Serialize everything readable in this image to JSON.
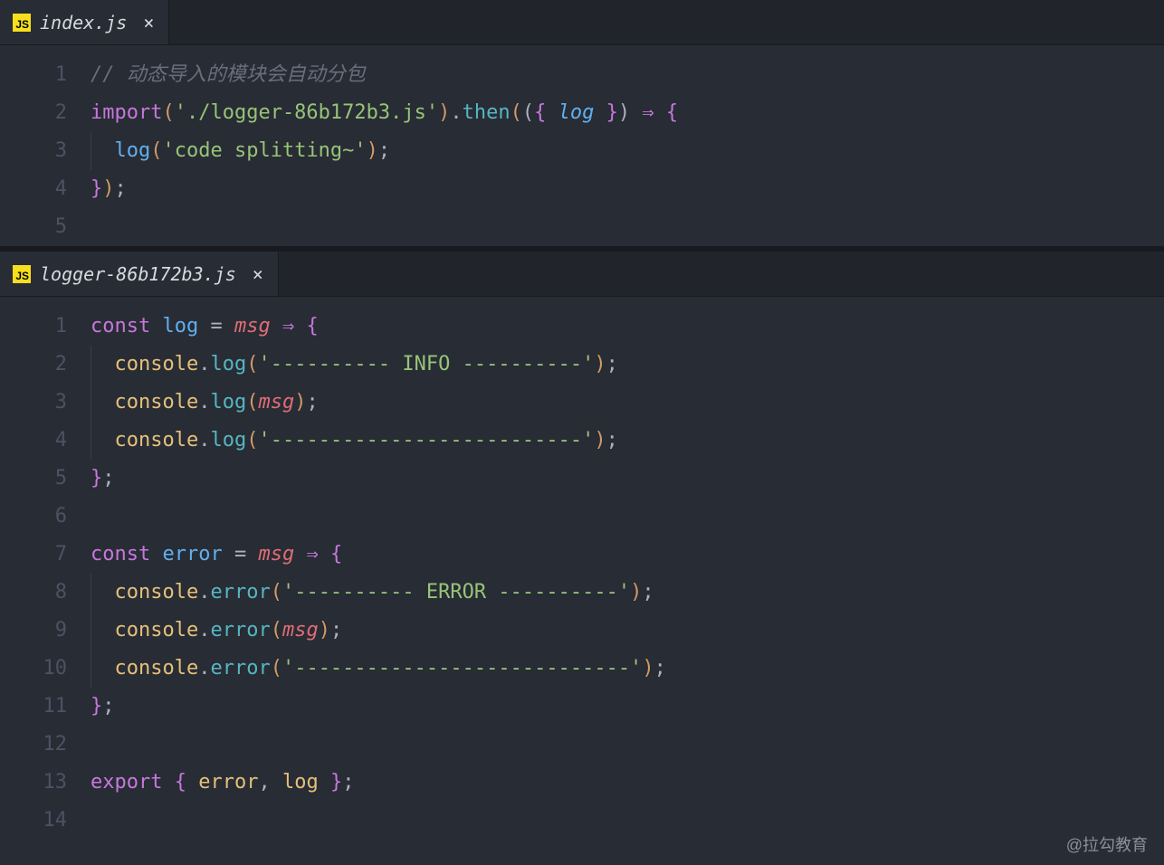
{
  "watermark": "@拉勾教育",
  "panes": [
    {
      "tab": {
        "filename": "index.js",
        "icon_label": "JS"
      },
      "lines": [
        {
          "n": "1",
          "tokens": [
            {
              "t": "// 动态导入的模块会自动分包",
              "c": "c-comment"
            }
          ]
        },
        {
          "n": "2",
          "tokens": [
            {
              "t": "import",
              "c": "c-keyword"
            },
            {
              "t": "(",
              "c": "c-bracket"
            },
            {
              "t": "'./logger-86b172b3.js'",
              "c": "c-string"
            },
            {
              "t": ")",
              "c": "c-bracket"
            },
            {
              "t": ".",
              "c": "c-punct"
            },
            {
              "t": "then",
              "c": "c-fn-teal"
            },
            {
              "t": "(",
              "c": "c-bracket"
            },
            {
              "t": "(",
              "c": "c-punct"
            },
            {
              "t": "{ ",
              "c": "c-brace"
            },
            {
              "t": "log",
              "c": "c-param-blue"
            },
            {
              "t": " }",
              "c": "c-brace"
            },
            {
              "t": ")",
              "c": "c-punct"
            },
            {
              "t": " ",
              "c": "c-punct"
            },
            {
              "t": "⇒",
              "c": "c-arrow"
            },
            {
              "t": " ",
              "c": "c-punct"
            },
            {
              "t": "{",
              "c": "c-brace"
            }
          ]
        },
        {
          "n": "3",
          "indent": 1,
          "tokens": [
            {
              "t": "  ",
              "c": "c-punct"
            },
            {
              "t": "log",
              "c": "c-fn"
            },
            {
              "t": "(",
              "c": "c-bracket"
            },
            {
              "t": "'code splitting~'",
              "c": "c-string"
            },
            {
              "t": ")",
              "c": "c-bracket"
            },
            {
              "t": ";",
              "c": "c-punct"
            }
          ]
        },
        {
          "n": "4",
          "tokens": [
            {
              "t": "}",
              "c": "c-brace"
            },
            {
              "t": ")",
              "c": "c-bracket"
            },
            {
              "t": ";",
              "c": "c-punct"
            }
          ]
        },
        {
          "n": "5",
          "tokens": []
        }
      ]
    },
    {
      "tab": {
        "filename": "logger-86b172b3.js",
        "icon_label": "JS"
      },
      "lines": [
        {
          "n": "1",
          "tokens": [
            {
              "t": "const",
              "c": "c-keyword"
            },
            {
              "t": " ",
              "c": ""
            },
            {
              "t": "log",
              "c": "c-fn"
            },
            {
              "t": " ",
              "c": ""
            },
            {
              "t": "=",
              "c": "c-punct"
            },
            {
              "t": " ",
              "c": ""
            },
            {
              "t": "msg",
              "c": "c-param"
            },
            {
              "t": " ",
              "c": ""
            },
            {
              "t": "⇒",
              "c": "c-arrow"
            },
            {
              "t": " ",
              "c": ""
            },
            {
              "t": "{",
              "c": "c-brace"
            }
          ]
        },
        {
          "n": "2",
          "indent": 1,
          "tokens": [
            {
              "t": "  ",
              "c": ""
            },
            {
              "t": "console",
              "c": "c-var"
            },
            {
              "t": ".",
              "c": "c-punct"
            },
            {
              "t": "log",
              "c": "c-fn-teal"
            },
            {
              "t": "(",
              "c": "c-bracket"
            },
            {
              "t": "'---------- INFO ----------'",
              "c": "c-string"
            },
            {
              "t": ")",
              "c": "c-bracket"
            },
            {
              "t": ";",
              "c": "c-punct"
            }
          ]
        },
        {
          "n": "3",
          "indent": 1,
          "tokens": [
            {
              "t": "  ",
              "c": ""
            },
            {
              "t": "console",
              "c": "c-var"
            },
            {
              "t": ".",
              "c": "c-punct"
            },
            {
              "t": "log",
              "c": "c-fn-teal"
            },
            {
              "t": "(",
              "c": "c-bracket"
            },
            {
              "t": "msg",
              "c": "c-param"
            },
            {
              "t": ")",
              "c": "c-bracket"
            },
            {
              "t": ";",
              "c": "c-punct"
            }
          ]
        },
        {
          "n": "4",
          "indent": 1,
          "tokens": [
            {
              "t": "  ",
              "c": ""
            },
            {
              "t": "console",
              "c": "c-var"
            },
            {
              "t": ".",
              "c": "c-punct"
            },
            {
              "t": "log",
              "c": "c-fn-teal"
            },
            {
              "t": "(",
              "c": "c-bracket"
            },
            {
              "t": "'--------------------------'",
              "c": "c-string"
            },
            {
              "t": ")",
              "c": "c-bracket"
            },
            {
              "t": ";",
              "c": "c-punct"
            }
          ]
        },
        {
          "n": "5",
          "tokens": [
            {
              "t": "}",
              "c": "c-brace"
            },
            {
              "t": ";",
              "c": "c-punct"
            }
          ]
        },
        {
          "n": "6",
          "tokens": []
        },
        {
          "n": "7",
          "tokens": [
            {
              "t": "const",
              "c": "c-keyword"
            },
            {
              "t": " ",
              "c": ""
            },
            {
              "t": "error",
              "c": "c-fn"
            },
            {
              "t": " ",
              "c": ""
            },
            {
              "t": "=",
              "c": "c-punct"
            },
            {
              "t": " ",
              "c": ""
            },
            {
              "t": "msg",
              "c": "c-param"
            },
            {
              "t": " ",
              "c": ""
            },
            {
              "t": "⇒",
              "c": "c-arrow"
            },
            {
              "t": " ",
              "c": ""
            },
            {
              "t": "{",
              "c": "c-brace"
            }
          ]
        },
        {
          "n": "8",
          "indent": 1,
          "tokens": [
            {
              "t": "  ",
              "c": ""
            },
            {
              "t": "console",
              "c": "c-var"
            },
            {
              "t": ".",
              "c": "c-punct"
            },
            {
              "t": "error",
              "c": "c-fn-teal"
            },
            {
              "t": "(",
              "c": "c-bracket"
            },
            {
              "t": "'---------- ERROR ----------'",
              "c": "c-string"
            },
            {
              "t": ")",
              "c": "c-bracket"
            },
            {
              "t": ";",
              "c": "c-punct"
            }
          ]
        },
        {
          "n": "9",
          "indent": 1,
          "tokens": [
            {
              "t": "  ",
              "c": ""
            },
            {
              "t": "console",
              "c": "c-var"
            },
            {
              "t": ".",
              "c": "c-punct"
            },
            {
              "t": "error",
              "c": "c-fn-teal"
            },
            {
              "t": "(",
              "c": "c-bracket"
            },
            {
              "t": "msg",
              "c": "c-param"
            },
            {
              "t": ")",
              "c": "c-bracket"
            },
            {
              "t": ";",
              "c": "c-punct"
            }
          ]
        },
        {
          "n": "10",
          "indent": 1,
          "tokens": [
            {
              "t": "  ",
              "c": ""
            },
            {
              "t": "console",
              "c": "c-var"
            },
            {
              "t": ".",
              "c": "c-punct"
            },
            {
              "t": "error",
              "c": "c-fn-teal"
            },
            {
              "t": "(",
              "c": "c-bracket"
            },
            {
              "t": "'----------------------------'",
              "c": "c-string"
            },
            {
              "t": ")",
              "c": "c-bracket"
            },
            {
              "t": ";",
              "c": "c-punct"
            }
          ]
        },
        {
          "n": "11",
          "tokens": [
            {
              "t": "}",
              "c": "c-brace"
            },
            {
              "t": ";",
              "c": "c-punct"
            }
          ]
        },
        {
          "n": "12",
          "tokens": []
        },
        {
          "n": "13",
          "tokens": [
            {
              "t": "export",
              "c": "c-keyword"
            },
            {
              "t": " ",
              "c": ""
            },
            {
              "t": "{",
              "c": "c-brace"
            },
            {
              "t": " ",
              "c": ""
            },
            {
              "t": "error",
              "c": "c-var"
            },
            {
              "t": ",",
              "c": "c-punct"
            },
            {
              "t": " ",
              "c": ""
            },
            {
              "t": "log",
              "c": "c-var"
            },
            {
              "t": " ",
              "c": ""
            },
            {
              "t": "}",
              "c": "c-brace"
            },
            {
              "t": ";",
              "c": "c-punct"
            }
          ]
        },
        {
          "n": "14",
          "tokens": []
        }
      ]
    }
  ]
}
